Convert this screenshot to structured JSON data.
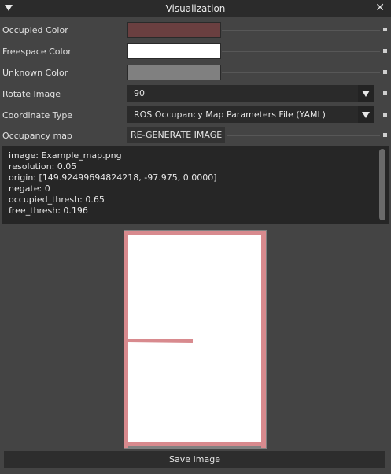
{
  "window": {
    "title": "Visualization"
  },
  "fields": {
    "occupied_color": {
      "label": "Occupied Color",
      "color": "#6a3f40"
    },
    "freespace_color": {
      "label": "Freespace Color",
      "color": "#ffffff"
    },
    "unknown_color": {
      "label": "Unknown Color",
      "color": "#808080"
    },
    "rotate_image": {
      "label": "Rotate Image",
      "value": "90"
    },
    "coordinate_type": {
      "label": "Coordinate Type",
      "value": "ROS Occupancy Map Parameters File (YAML)"
    },
    "occupancy_map": {
      "label": "Occupancy map",
      "button": "RE-GENERATE IMAGE"
    }
  },
  "yaml_lines": [
    "image: Example_map.png",
    "resolution: 0.05",
    "origin: [149.92499694824218, -97.975, 0.0000]",
    "negate: 0",
    "occupied_thresh: 0.65",
    "free_thresh: 0.196"
  ],
  "map_colors": {
    "wall": "#d88a8e",
    "free": "#ffffff",
    "unknown": "#808080"
  },
  "save_button": "Save Image"
}
